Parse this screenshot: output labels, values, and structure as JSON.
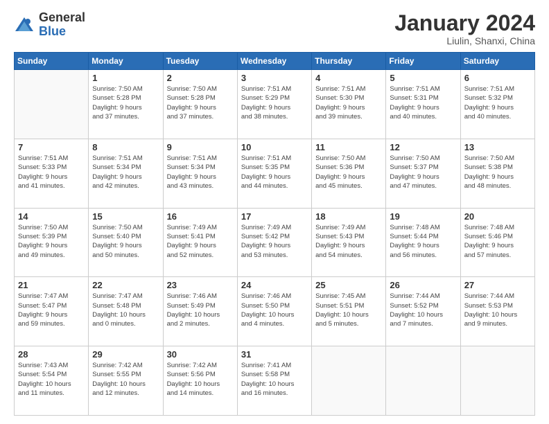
{
  "logo": {
    "general": "General",
    "blue": "Blue"
  },
  "header": {
    "month": "January 2024",
    "location": "Liulin, Shanxi, China"
  },
  "weekdays": [
    "Sunday",
    "Monday",
    "Tuesday",
    "Wednesday",
    "Thursday",
    "Friday",
    "Saturday"
  ],
  "weeks": [
    [
      {
        "day": "",
        "info": ""
      },
      {
        "day": "1",
        "info": "Sunrise: 7:50 AM\nSunset: 5:28 PM\nDaylight: 9 hours\nand 37 minutes."
      },
      {
        "day": "2",
        "info": "Sunrise: 7:50 AM\nSunset: 5:28 PM\nDaylight: 9 hours\nand 37 minutes."
      },
      {
        "day": "3",
        "info": "Sunrise: 7:51 AM\nSunset: 5:29 PM\nDaylight: 9 hours\nand 38 minutes."
      },
      {
        "day": "4",
        "info": "Sunrise: 7:51 AM\nSunset: 5:30 PM\nDaylight: 9 hours\nand 39 minutes."
      },
      {
        "day": "5",
        "info": "Sunrise: 7:51 AM\nSunset: 5:31 PM\nDaylight: 9 hours\nand 40 minutes."
      },
      {
        "day": "6",
        "info": "Sunrise: 7:51 AM\nSunset: 5:32 PM\nDaylight: 9 hours\nand 40 minutes."
      }
    ],
    [
      {
        "day": "7",
        "info": "Sunrise: 7:51 AM\nSunset: 5:33 PM\nDaylight: 9 hours\nand 41 minutes."
      },
      {
        "day": "8",
        "info": "Sunrise: 7:51 AM\nSunset: 5:34 PM\nDaylight: 9 hours\nand 42 minutes."
      },
      {
        "day": "9",
        "info": "Sunrise: 7:51 AM\nSunset: 5:34 PM\nDaylight: 9 hours\nand 43 minutes."
      },
      {
        "day": "10",
        "info": "Sunrise: 7:51 AM\nSunset: 5:35 PM\nDaylight: 9 hours\nand 44 minutes."
      },
      {
        "day": "11",
        "info": "Sunrise: 7:50 AM\nSunset: 5:36 PM\nDaylight: 9 hours\nand 45 minutes."
      },
      {
        "day": "12",
        "info": "Sunrise: 7:50 AM\nSunset: 5:37 PM\nDaylight: 9 hours\nand 47 minutes."
      },
      {
        "day": "13",
        "info": "Sunrise: 7:50 AM\nSunset: 5:38 PM\nDaylight: 9 hours\nand 48 minutes."
      }
    ],
    [
      {
        "day": "14",
        "info": "Sunrise: 7:50 AM\nSunset: 5:39 PM\nDaylight: 9 hours\nand 49 minutes."
      },
      {
        "day": "15",
        "info": "Sunrise: 7:50 AM\nSunset: 5:40 PM\nDaylight: 9 hours\nand 50 minutes."
      },
      {
        "day": "16",
        "info": "Sunrise: 7:49 AM\nSunset: 5:41 PM\nDaylight: 9 hours\nand 52 minutes."
      },
      {
        "day": "17",
        "info": "Sunrise: 7:49 AM\nSunset: 5:42 PM\nDaylight: 9 hours\nand 53 minutes."
      },
      {
        "day": "18",
        "info": "Sunrise: 7:49 AM\nSunset: 5:43 PM\nDaylight: 9 hours\nand 54 minutes."
      },
      {
        "day": "19",
        "info": "Sunrise: 7:48 AM\nSunset: 5:44 PM\nDaylight: 9 hours\nand 56 minutes."
      },
      {
        "day": "20",
        "info": "Sunrise: 7:48 AM\nSunset: 5:46 PM\nDaylight: 9 hours\nand 57 minutes."
      }
    ],
    [
      {
        "day": "21",
        "info": "Sunrise: 7:47 AM\nSunset: 5:47 PM\nDaylight: 9 hours\nand 59 minutes."
      },
      {
        "day": "22",
        "info": "Sunrise: 7:47 AM\nSunset: 5:48 PM\nDaylight: 10 hours\nand 0 minutes."
      },
      {
        "day": "23",
        "info": "Sunrise: 7:46 AM\nSunset: 5:49 PM\nDaylight: 10 hours\nand 2 minutes."
      },
      {
        "day": "24",
        "info": "Sunrise: 7:46 AM\nSunset: 5:50 PM\nDaylight: 10 hours\nand 4 minutes."
      },
      {
        "day": "25",
        "info": "Sunrise: 7:45 AM\nSunset: 5:51 PM\nDaylight: 10 hours\nand 5 minutes."
      },
      {
        "day": "26",
        "info": "Sunrise: 7:44 AM\nSunset: 5:52 PM\nDaylight: 10 hours\nand 7 minutes."
      },
      {
        "day": "27",
        "info": "Sunrise: 7:44 AM\nSunset: 5:53 PM\nDaylight: 10 hours\nand 9 minutes."
      }
    ],
    [
      {
        "day": "28",
        "info": "Sunrise: 7:43 AM\nSunset: 5:54 PM\nDaylight: 10 hours\nand 11 minutes."
      },
      {
        "day": "29",
        "info": "Sunrise: 7:42 AM\nSunset: 5:55 PM\nDaylight: 10 hours\nand 12 minutes."
      },
      {
        "day": "30",
        "info": "Sunrise: 7:42 AM\nSunset: 5:56 PM\nDaylight: 10 hours\nand 14 minutes."
      },
      {
        "day": "31",
        "info": "Sunrise: 7:41 AM\nSunset: 5:58 PM\nDaylight: 10 hours\nand 16 minutes."
      },
      {
        "day": "",
        "info": ""
      },
      {
        "day": "",
        "info": ""
      },
      {
        "day": "",
        "info": ""
      }
    ]
  ]
}
